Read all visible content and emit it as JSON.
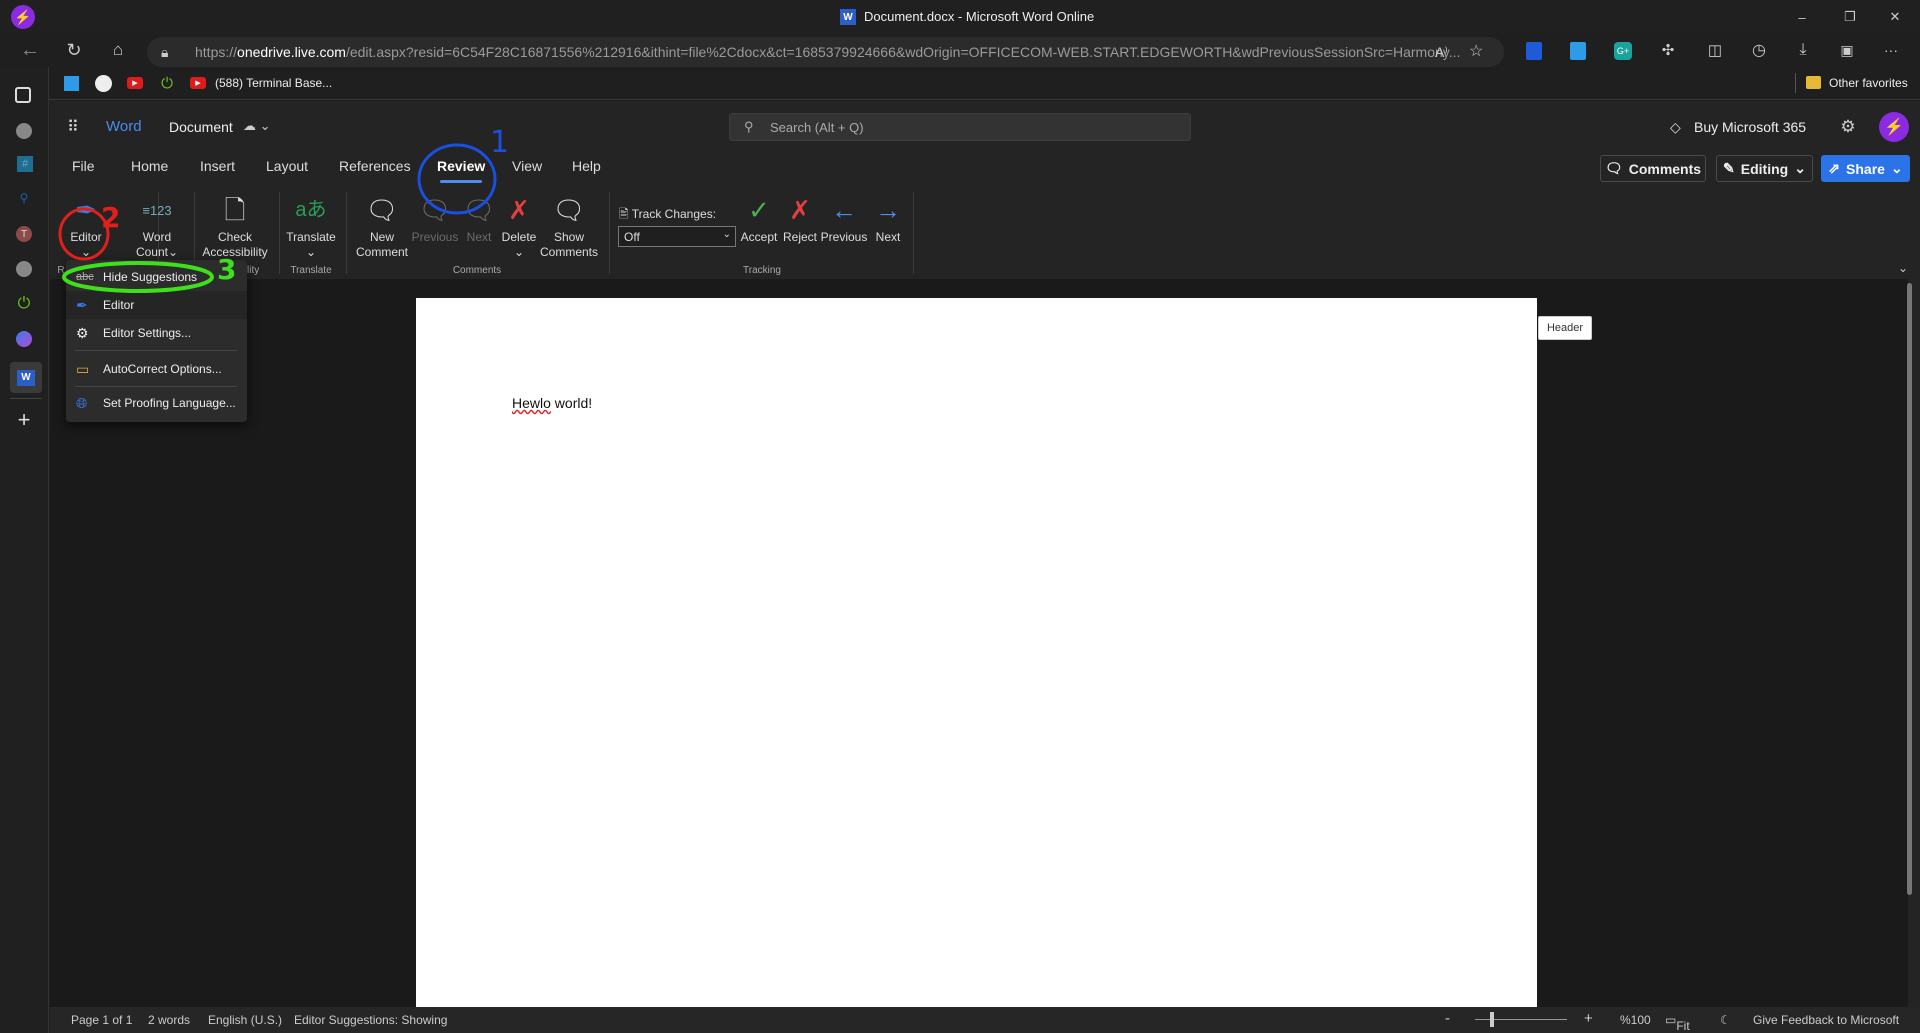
{
  "window": {
    "title": "Document.docx - Microsoft Word Online",
    "minimize": "–",
    "restore": "❐",
    "close": "✕"
  },
  "browser": {
    "url_host": "https://onedrive.live.com",
    "url_path": "/edit.aspx?resid=6C54F28C16871556%212916&ithint=file%2Cdocx&ct=1685379924666&wdOrigin=OFFICECOM-WEB.START.EDGEWORTH&wdPreviousSessionSrc=Harmony...",
    "url_scheme": "https://",
    "url_domain": "onedrive.live.com",
    "read_aloud": "A⁾",
    "more": "···"
  },
  "favorites": {
    "items": [
      {
        "label": "(588) Terminal Base..."
      }
    ],
    "other": "Other favorites"
  },
  "word": {
    "app_name": "Word",
    "doc_name": "Document",
    "search_placeholder": "Search (Alt + Q)",
    "buy": "Buy Microsoft 365",
    "comments": "Comments",
    "editing": "Editing",
    "share": "Share"
  },
  "tabs": [
    "File",
    "Home",
    "Insert",
    "Layout",
    "References",
    "Review",
    "View",
    "Help"
  ],
  "ribbon": {
    "editor": "Editor",
    "word_count_1": "Word",
    "word_count_2": "Count",
    "check_1": "Check",
    "check_2": "Accessibility",
    "translate": "Translate",
    "new_comment_1": "New",
    "new_comment_2": "Comment",
    "previous": "Previous",
    "next": "Next",
    "delete": "Delete",
    "show_1": "Show",
    "show_2": "Comments",
    "track_label": "Track Changes:",
    "track_value": "Off",
    "accept": "Accept",
    "reject": "Reject",
    "t_previous": "Previous",
    "t_next": "Next",
    "groups": {
      "review": "R",
      "accessibility": "ility",
      "translate": "Translate",
      "comments": "Comments",
      "tracking": "Tracking"
    }
  },
  "menu": [
    "Hide Suggestions",
    "Editor",
    "Editor Settings...",
    "AutoCorrect Options...",
    "Set Proofing Language..."
  ],
  "document": {
    "misspelled": "Hewlo",
    "rest": " world!",
    "header_tooltip": "Header"
  },
  "status": {
    "page": "Page 1 of 1",
    "words": "2 words",
    "language": "English (U.S.)",
    "suggestions": "Editor Suggestions: Showing",
    "zoom": "%100",
    "fit": "Fit",
    "feedback": "Give Feedback to Microsoft",
    "zoom_out": "-",
    "zoom_in": "+"
  },
  "annotations": {
    "one": "1",
    "two": "2",
    "three": "3"
  },
  "colors": {
    "accent": "#2b73e6",
    "word_blue": "#4a8cf0",
    "ann_blue": "#1a4fe0",
    "ann_red": "#e0201c",
    "ann_green": "#3ee01c"
  }
}
